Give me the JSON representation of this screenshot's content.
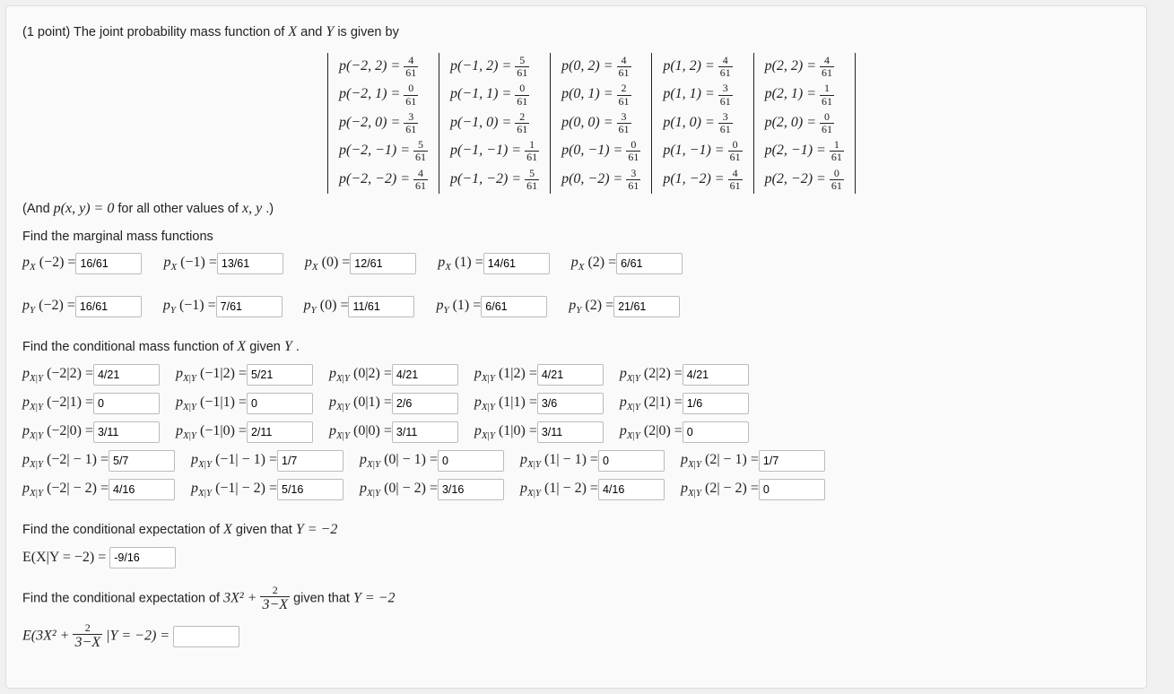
{
  "title_prefix": "(1 point) The joint probability mass function of ",
  "title_mid": " and ",
  "title_suffix": " is given by",
  "X": "X",
  "Y": "Y",
  "x": "x",
  "y": "y",
  "zero_note_pre": "(And ",
  "zero_note_mid": " for all other values of ",
  "zero_note_post": ".)",
  "pxy": "p(x, y) = 0",
  "xy": "x, y",
  "find_marginal": "Find the marginal mass functions",
  "find_cond": "Find the conditional mass function of ",
  "given": " given ",
  "period": ".",
  "find_exp_pre": "Find the conditional expectation of ",
  "given_that": " given that ",
  "Yneg2": "Y = −2",
  "E1lhs": "E(X|Y = −2) = ",
  "find_exp2_func": "3X² + ",
  "frac2_3mX_n": "2",
  "frac2_3mX_d": "3−X",
  "E2lhs": "E(3X² + ",
  "E2lhs2": " |Y = −2) = ",
  "inputs": {
    "px": {
      "m2": "16/61",
      "m1": "13/61",
      "0": "12/61",
      "1": "14/61",
      "2": "6/61"
    },
    "py": {
      "m2": "16/61",
      "m1": "7/61",
      "0": "11/61",
      "1": "6/61",
      "2": "21/61"
    },
    "pxgy": {
      "y2": {
        "m2": "4/21",
        "m1": "5/21",
        "0": "4/21",
        "1": "4/21",
        "2": "4/21"
      },
      "y1": {
        "m2": "0",
        "m1": "0",
        "0": "2/6",
        "1": "3/6",
        "2": "1/6"
      },
      "y0": {
        "m2": "3/11",
        "m1": "2/11",
        "0": "3/11",
        "1": "3/11",
        "2": "0"
      },
      "ym1": {
        "m2": "5/7",
        "m1": "1/7",
        "0": "0",
        "1": "0",
        "2": "1/7"
      },
      "ym2": {
        "m2": "4/16",
        "m1": "5/16",
        "0": "3/16",
        "1": "4/16",
        "2": "0"
      }
    },
    "E1": "-9/16",
    "E2": ""
  },
  "joint": {
    "rows": [
      [
        [
          "p(−2, 2)",
          "4",
          "61"
        ],
        [
          "p(−1, 2)",
          "5",
          "61"
        ],
        [
          "p(0, 2)",
          "4",
          "61"
        ],
        [
          "p(1, 2)",
          "4",
          "61"
        ],
        [
          "p(2, 2)",
          "4",
          "61"
        ]
      ],
      [
        [
          "p(−2, 1)",
          "0",
          "61"
        ],
        [
          "p(−1, 1)",
          "0",
          "61"
        ],
        [
          "p(0, 1)",
          "2",
          "61"
        ],
        [
          "p(1, 1)",
          "3",
          "61"
        ],
        [
          "p(2, 1)",
          "1",
          "61"
        ]
      ],
      [
        [
          "p(−2, 0)",
          "3",
          "61"
        ],
        [
          "p(−1, 0)",
          "2",
          "61"
        ],
        [
          "p(0, 0)",
          "3",
          "61"
        ],
        [
          "p(1, 0)",
          "3",
          "61"
        ],
        [
          "p(2, 0)",
          "0",
          "61"
        ]
      ],
      [
        [
          "p(−2, −1)",
          "5",
          "61"
        ],
        [
          "p(−1, −1)",
          "1",
          "61"
        ],
        [
          "p(0, −1)",
          "0",
          "61"
        ],
        [
          "p(1, −1)",
          "0",
          "61"
        ],
        [
          "p(2, −1)",
          "1",
          "61"
        ]
      ],
      [
        [
          "p(−2, −2)",
          "4",
          "61"
        ],
        [
          "p(−1, −2)",
          "5",
          "61"
        ],
        [
          "p(0, −2)",
          "3",
          "61"
        ],
        [
          "p(1, −2)",
          "4",
          "61"
        ],
        [
          "p(2, −2)",
          "0",
          "61"
        ]
      ]
    ]
  },
  "pxlabels": {
    "m2": "(−2) = ",
    "m1": "(−1) = ",
    "0": "(0) = ",
    "1": "(1) = ",
    "2": "(2) = "
  },
  "pxgylabels": {
    "y2": {
      "m2": "(−2|2) = ",
      "m1": "(−1|2) = ",
      "0": "(0|2) = ",
      "1": "(1|2) = ",
      "2": "(2|2) = "
    },
    "y1": {
      "m2": "(−2|1) = ",
      "m1": "(−1|1) = ",
      "0": "(0|1) = ",
      "1": "(1|1) = ",
      "2": "(2|1) = "
    },
    "y0": {
      "m2": "(−2|0) = ",
      "m1": "(−1|0) = ",
      "0": "(0|0) = ",
      "1": "(1|0) = ",
      "2": "(2|0) = "
    },
    "ym1": {
      "m2": "(−2| − 1) = ",
      "m1": "(−1| − 1) = ",
      "0": "(0| − 1) = ",
      "1": "(1| − 1) = ",
      "2": "(2| − 1) = "
    },
    "ym2": {
      "m2": "(−2| − 2) = ",
      "m1": "(−1| − 2) = ",
      "0": "(0| − 2) = ",
      "1": "(1| − 2) = ",
      "2": "(2| − 2) = "
    }
  }
}
